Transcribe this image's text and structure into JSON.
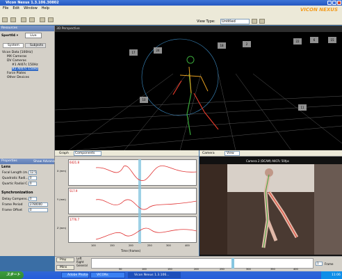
{
  "app": {
    "title": "Vicon Nexus 1.3.106.30802",
    "brand": "VICON NEXUS"
  },
  "menu": [
    "File",
    "Edit",
    "Window",
    "Help"
  ],
  "toolbar": {
    "view_type_label": "View Type:",
    "view_type_value": "Untitled"
  },
  "left": {
    "resources_header": "Resources",
    "system_name": "Sport04 ▾",
    "live_button": "Live",
    "tabs": [
      "System",
      "Subjects"
    ],
    "tree": [
      "Vicon Data [100Hz]",
      "MX Cameras",
      "DV Cameras",
      "#1 All07c 150Hz",
      "#2 All07c 150Hz",
      "Force Plates",
      "Other Devices"
    ],
    "properties_header": "Properties",
    "properties_tab": "Show Advanced",
    "lens_title": "Lens",
    "lens": [
      {
        "label": "Focal Length (m...",
        "value": "12.5"
      },
      {
        "label": "Quadratic Radi...",
        "value": "0"
      },
      {
        "label": "Quartic Radial C...",
        "value": "0"
      }
    ],
    "sync_title": "Synchronization",
    "sync": [
      {
        "label": "Delay Compens...",
        "value": "0"
      },
      {
        "label": "Frame Period",
        "value": "2780000"
      },
      {
        "label": "Frame Offset",
        "value": "0"
      }
    ]
  },
  "viewport": {
    "title": "3D Perspective",
    "camera_labels": [
      "17",
      "24",
      "18",
      "2",
      "22",
      "6",
      "15",
      "10",
      "11"
    ]
  },
  "graph": {
    "title": "Graph",
    "mode": "Components",
    "plots": [
      {
        "label": "6421.8",
        "axis": "X (mm)"
      },
      {
        "label": "517.9",
        "axis": "Y (mm)"
      },
      {
        "label": "1776.7",
        "axis": "Z (mm)"
      }
    ],
    "xticks": [
      "100",
      "150",
      "200",
      "250",
      "300",
      "350",
      "400"
    ],
    "xlabel": "Time (frames)"
  },
  "camera": {
    "title": "Camera",
    "view_button": "View",
    "caption": "Camera 2 (DCAM) All07c 50fps"
  },
  "timeline": {
    "play": "Play",
    "mode": "Left",
    "right": "Right",
    "general": "General",
    "mins": "Mins",
    "ticks": [
      "50",
      "100",
      "150",
      "200",
      "250",
      "300",
      "350",
      "400"
    ],
    "speed": "1",
    "label": "Frame"
  },
  "taskbar": {
    "start": "スタート",
    "tasks": [
      "Adobe Photoshop",
      "VICONs",
      "Vicon Nexus 1.3.106..."
    ],
    "clock": "11:06"
  }
}
